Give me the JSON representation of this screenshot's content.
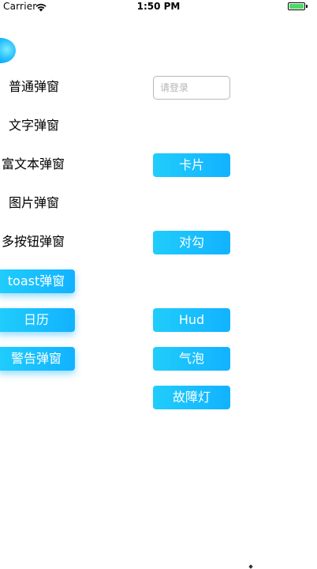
{
  "status_bar": {
    "carrier": "Carrier",
    "time": "1:50 PM",
    "battery_color": "#4cd964",
    "wifi_icon": "wifi-icon",
    "battery_icon": "battery-icon"
  },
  "menu": {
    "normal_popup": "普通弹窗",
    "text_popup": "文字弹窗",
    "rich_text_popup": "富文本弹窗",
    "image_popup": "图片弹窗",
    "multi_button_popup": "多按钮弹窗",
    "toast_popup": "toast弹窗",
    "calendar": "日历",
    "alert_popup": "警告弹窗"
  },
  "right_column": {
    "login_placeholder": "请登录",
    "card": "卡片",
    "checkmark": "对勾",
    "hud": "Hud",
    "bubble": "气泡",
    "fault_light": "故障灯"
  },
  "colors": {
    "accent_start": "#20cdfb",
    "accent_end": "#12b2ff"
  }
}
